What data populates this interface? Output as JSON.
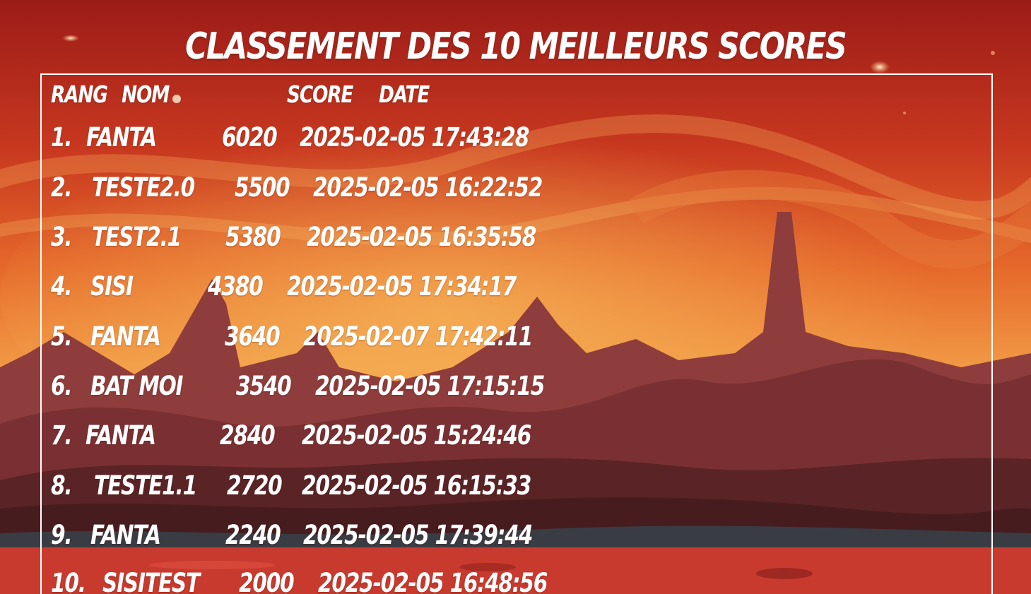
{
  "title": "CLASSEMENT DES 10 MEILLEURS SCORES",
  "headers": {
    "rank": "RANG",
    "name": "NOM",
    "score": "SCORE",
    "date": "DATE"
  },
  "rows": [
    {
      "rank": "1.",
      "name": "FANTA",
      "score": "6020",
      "date": "2025-02-05 17:43:28"
    },
    {
      "rank": "2.",
      "name": "TESTE2.0",
      "score": "5500",
      "date": "2025-02-05 16:22:52"
    },
    {
      "rank": "3.",
      "name": "TEST2.1",
      "score": "5380",
      "date": "2025-02-05 16:35:58"
    },
    {
      "rank": "4.",
      "name": "SISI",
      "score": "4380",
      "date": "2025-02-05 17:34:17"
    },
    {
      "rank": "5.",
      "name": "FANTA",
      "score": "3640",
      "date": "2025-02-07 17:42:11"
    },
    {
      "rank": "6.",
      "name": "BAT MOI",
      "score": "3540",
      "date": "2025-02-05 17:15:15"
    },
    {
      "rank": "7.",
      "name": "FANTA",
      "score": "2840",
      "date": "2025-02-05 15:24:46"
    },
    {
      "rank": "8.",
      "name": "TESTE1.1",
      "score": "2720",
      "date": "2025-02-05 16:15:33"
    },
    {
      "rank": "9.",
      "name": "FANTA",
      "score": "2240",
      "date": "2025-02-05 17:39:44"
    },
    {
      "rank": "10.",
      "name": "SISITEST",
      "score": "2000",
      "date": "2025-02-05 16:48:56"
    }
  ],
  "colors": {
    "text": "#ffffff",
    "sky_top": "#a8201a",
    "sky_mid": "#e56a2a",
    "sky_glow": "#f0a64a",
    "rock": "#8e3d3c",
    "rock_dark": "#4a1e20",
    "ground": "#c93a2e"
  }
}
